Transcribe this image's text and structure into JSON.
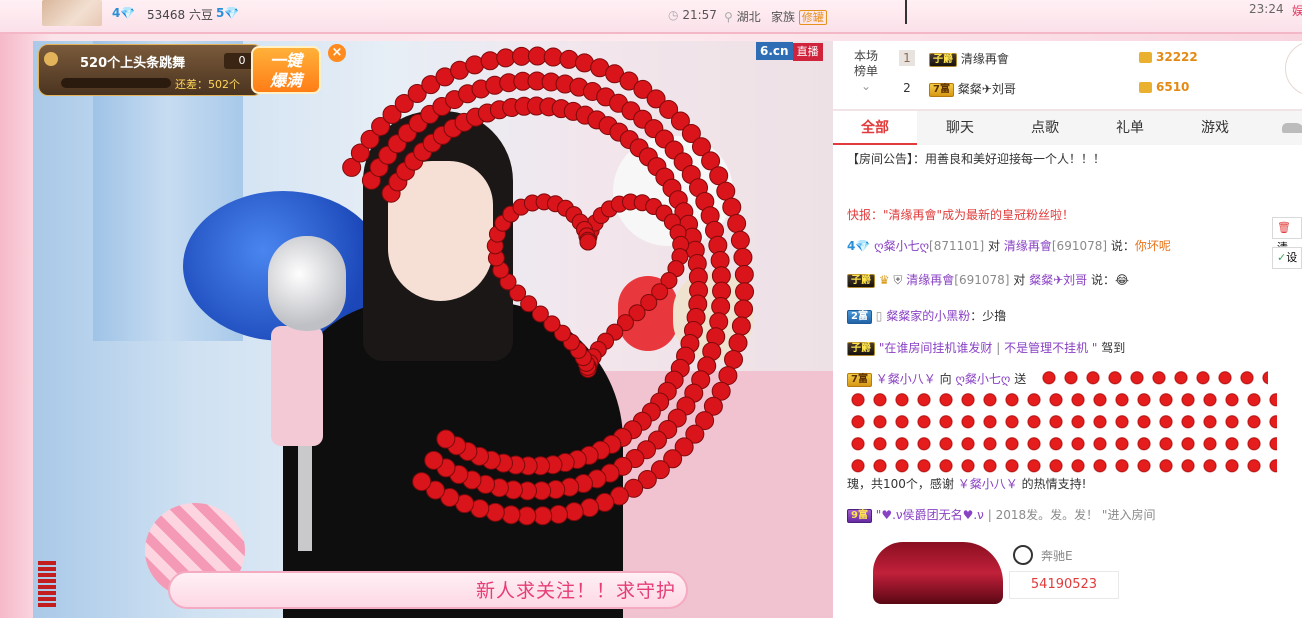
{
  "header": {
    "user_level_a": "4",
    "beans": "53468 六豆",
    "user_level_b": "5",
    "time": "21:57",
    "location": "湖北",
    "family_label": "家族",
    "family_tag": "修罐",
    "clock_right": "23:24",
    "right_link": "娱"
  },
  "video": {
    "task_title": "520个上头条跳舞",
    "task_count": "0",
    "task_progress": 0.0,
    "task_remaining": "还差：502个",
    "onekey_line1": "一键",
    "onekey_line2": "爆满",
    "close": "×",
    "logo_a": "6.cn",
    "logo_b": "直播",
    "banner_text": "新人求关注！！求守护"
  },
  "panel": {
    "rank_label": "本场榜单",
    "rank_rows": [
      {
        "idx": "1",
        "badge": "子爵",
        "name": "清缘再會",
        "score": "32222"
      },
      {
        "idx": "2",
        "badge": "7富",
        "name": "粲粲✈刘哥",
        "score": "6510"
      }
    ],
    "tabs": [
      "全部",
      "聊天",
      "点歌",
      "礼单",
      "游戏"
    ],
    "chat": {
      "notice_label": "【房间公告】",
      "notice_text": "：用善良和美好迎接每一个人！！！",
      "flash": "快报：\"清缘再會\"成为最新的皇冠粉丝啦！",
      "m1_lvl": "4",
      "m1_from": "ღ粲小七ღ",
      "m1_from_id": "[871101]",
      "m1_to_word": "对",
      "m1_to": "清缘再會",
      "m1_to_id": "[691078]",
      "m1_say": "说：",
      "m1_text": "你坏呢",
      "m2_badge": "子爵",
      "m2_from": "清缘再會",
      "m2_from_id": "[691078]",
      "m2_to_word": "对",
      "m2_to": "粲粲✈刘哥",
      "m2_say": "说：",
      "m2_text": "😂",
      "m3_badge": "2富",
      "m3_from": "粲粲家的小黑粉",
      "m3_text": "：少撸",
      "m4_badge": "子爵",
      "m4_text1": "\"在谁房间挂机谁发财",
      "m4_sep": "|",
      "m4_text2": "不是管理不挂机 \"",
      "m4_arrive": "驾到",
      "m5_badge": "7富",
      "m5_from": "￥粲小八￥",
      "m5_to_word": "向",
      "m5_to": "ღ粲小七ღ",
      "m5_give": "送",
      "m5_tail_a": "瑰，共100个，感谢",
      "m5_tail_name": "￥粲小八￥",
      "m5_tail_b": "的热情支持!",
      "m6_badge": "9富",
      "m6_from": "\"♥.ν侯爵团无名♥.ν",
      "m6_sep": "|",
      "m6_text": "2018发。发。发！ \"进入房间",
      "car_name": "奔驰E",
      "car_id": "54190523"
    },
    "side_buttons": [
      "清",
      "设"
    ]
  }
}
